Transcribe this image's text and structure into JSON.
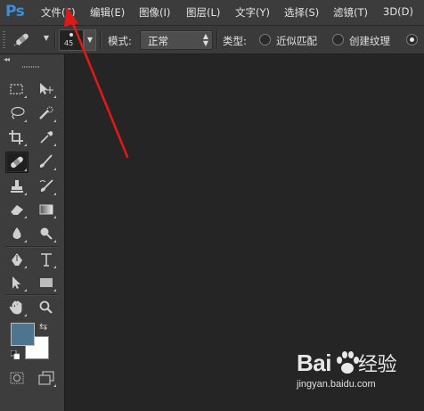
{
  "app": {
    "logo": "Ps"
  },
  "menu": [
    "文件(F)",
    "编辑(E)",
    "图像(I)",
    "图层(L)",
    "文字(Y)",
    "选择(S)",
    "滤镜(T)",
    "3D(D)"
  ],
  "options": {
    "brush_size": "45",
    "mode_label": "模式:",
    "mode_value": "正常",
    "type_label": "类型:",
    "type_options": [
      {
        "label": "近似匹配",
        "selected": false
      },
      {
        "label": "创建纹理",
        "selected": false
      },
      {
        "label": "",
        "selected": true
      }
    ]
  },
  "toolbox": {
    "collapse": "◂◂",
    "tools": [
      "rectangular-marquee",
      "move",
      "lasso",
      "quick-selection",
      "crop",
      "eyedropper",
      "spot-healing-brush",
      "brush",
      "clone-stamp",
      "history-brush",
      "eraser",
      "gradient",
      "blur",
      "dodge",
      "pen",
      "type",
      "path-selection",
      "rectangle",
      "hand",
      "zoom"
    ],
    "active_tool": "spot-healing-brush",
    "foreground_color": "#4d7590",
    "background_color": "#ffffff",
    "swap_glyph": "⇆"
  },
  "annotation": {
    "arrow_color": "#e01818"
  },
  "watermark": {
    "brand_a": "Bai",
    "brand_b": "经验",
    "url": "jingyan.baidu.com"
  }
}
